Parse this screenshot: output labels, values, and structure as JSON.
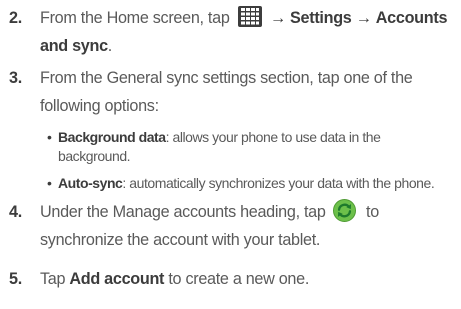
{
  "steps": [
    {
      "number": "2.",
      "prefix": "From the Home screen, tap",
      "arrow1": "→",
      "settings": "Settings",
      "arrow2": "→",
      "accounts_line1": "Accounts",
      "accounts_line2": "and sync",
      "period": "."
    },
    {
      "number": "3.",
      "text_line1": "From the General sync settings section, tap one of the",
      "text_line2": "following options:"
    },
    {
      "number": "4.",
      "prefix": "Under the Manage accounts heading, tap",
      "suffix": "to",
      "text_line2": "synchronize the account with your tablet."
    },
    {
      "number": "5.",
      "prefix": "Tap",
      "bold": "Add account",
      "suffix": "to create a new one."
    }
  ],
  "options": [
    {
      "bullet": "•",
      "term": "Background data",
      "desc_line1": ": allows your phone to use data in the",
      "desc_line2": "background."
    },
    {
      "bullet": "•",
      "term": "Auto-sync",
      "desc": ": automatically synchronizes your data with the phone."
    }
  ],
  "icons": {
    "apps": "apps-grid-icon",
    "sync": "sync-icon"
  },
  "colors": {
    "text": "#5a5a5a",
    "bold": "#3c3c3c",
    "grid_icon": "#3d3d3d",
    "sync_green": "#6cc04a",
    "sync_arrows": "#1e7a2c"
  }
}
